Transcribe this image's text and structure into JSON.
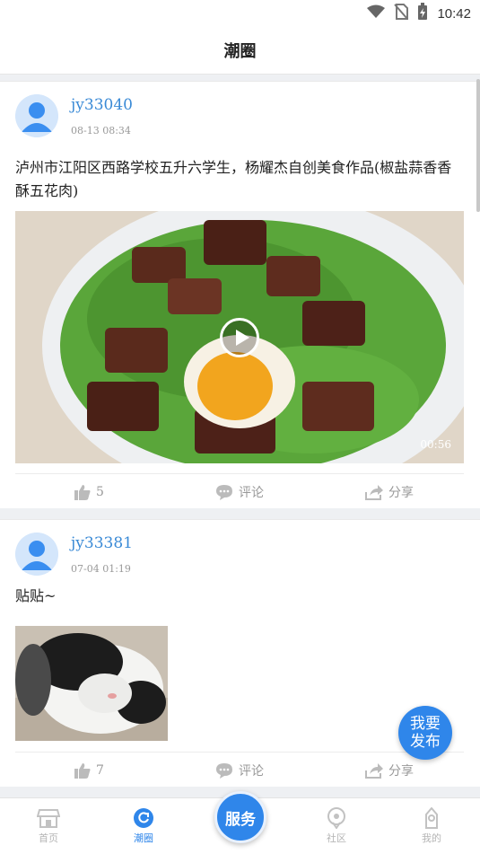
{
  "status_bar": {
    "time": "10:42",
    "icons": [
      "wifi-icon",
      "no-sim-icon",
      "battery-charging-icon"
    ]
  },
  "header": {
    "title": "潮圈"
  },
  "posts": [
    {
      "username": "jy33040",
      "timestamp": "08-13 08:34",
      "text": "泸州市江阳区西路学校五升六学生，杨耀杰自创美食作品(椒盐蒜香香酥五花肉)",
      "media": {
        "type": "video",
        "duration": "00:56"
      },
      "likes": "5",
      "comment_label": "评论",
      "share_label": "分享"
    },
    {
      "username": "jy33381",
      "timestamp": "07-04 01:19",
      "text": "贴贴~",
      "media": {
        "type": "photo"
      },
      "likes": "7",
      "comment_label": "评论",
      "share_label": "分享"
    }
  ],
  "fab": {
    "line1": "我要",
    "line2": "发布"
  },
  "bottom_nav": {
    "home": "首页",
    "circle": "潮圈",
    "service": "服务",
    "community": "社区",
    "mine": "我的"
  },
  "colors": {
    "accent": "#2f86ea",
    "username": "#3a8ad6"
  }
}
